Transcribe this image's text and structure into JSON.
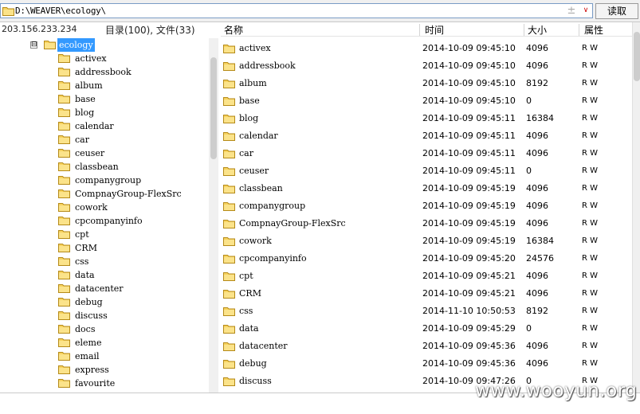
{
  "path_bar": {
    "path": "D:\\WEAVER\\ecology\\",
    "read_button": "读取",
    "add_glyph": "±",
    "dropdown_glyph": "∨"
  },
  "left": {
    "ip": "203.156.233.234",
    "counts": "目录(100), 文件(33)",
    "expander": "⊟",
    "root": "ecology",
    "tree_items": [
      "activex",
      "addressbook",
      "album",
      "base",
      "blog",
      "calendar",
      "car",
      "ceuser",
      "classbean",
      "companygroup",
      "CompnayGroup-FlexSrc",
      "cowork",
      "cpcompanyinfo",
      "cpt",
      "CRM",
      "css",
      "data",
      "datacenter",
      "debug",
      "discuss",
      "docs",
      "eleme",
      "email",
      "express",
      "favourite"
    ]
  },
  "columns": {
    "name": "名称",
    "time": "时间",
    "size": "大小",
    "attr": "属性"
  },
  "files": [
    {
      "name": "activex",
      "time": "2014-10-09 09:45:10",
      "size": "4096",
      "attr": "R W"
    },
    {
      "name": "addressbook",
      "time": "2014-10-09 09:45:10",
      "size": "4096",
      "attr": "R W"
    },
    {
      "name": "album",
      "time": "2014-10-09 09:45:10",
      "size": "8192",
      "attr": "R W"
    },
    {
      "name": "base",
      "time": "2014-10-09 09:45:10",
      "size": "0",
      "attr": "R W"
    },
    {
      "name": "blog",
      "time": "2014-10-09 09:45:11",
      "size": "16384",
      "attr": "R W"
    },
    {
      "name": "calendar",
      "time": "2014-10-09 09:45:11",
      "size": "4096",
      "attr": "R W"
    },
    {
      "name": "car",
      "time": "2014-10-09 09:45:11",
      "size": "4096",
      "attr": "R W"
    },
    {
      "name": "ceuser",
      "time": "2014-10-09 09:45:11",
      "size": "0",
      "attr": "R W"
    },
    {
      "name": "classbean",
      "time": "2014-10-09 09:45:19",
      "size": "4096",
      "attr": "R W"
    },
    {
      "name": "companygroup",
      "time": "2014-10-09 09:45:19",
      "size": "4096",
      "attr": "R W"
    },
    {
      "name": "CompnayGroup-FlexSrc",
      "time": "2014-10-09 09:45:19",
      "size": "4096",
      "attr": "R W"
    },
    {
      "name": "cowork",
      "time": "2014-10-09 09:45:19",
      "size": "16384",
      "attr": "R W"
    },
    {
      "name": "cpcompanyinfo",
      "time": "2014-10-09 09:45:20",
      "size": "24576",
      "attr": "R W"
    },
    {
      "name": "cpt",
      "time": "2014-10-09 09:45:21",
      "size": "4096",
      "attr": "R W"
    },
    {
      "name": "CRM",
      "time": "2014-10-09 09:45:21",
      "size": "4096",
      "attr": "R W"
    },
    {
      "name": "css",
      "time": "2014-11-10 10:50:53",
      "size": "8192",
      "attr": "R W"
    },
    {
      "name": "data",
      "time": "2014-10-09 09:45:29",
      "size": "0",
      "attr": "R W"
    },
    {
      "name": "datacenter",
      "time": "2014-10-09 09:45:36",
      "size": "4096",
      "attr": "R W"
    },
    {
      "name": "debug",
      "time": "2014-10-09 09:45:36",
      "size": "4096",
      "attr": "R W"
    },
    {
      "name": "discuss",
      "time": "2014-10-09 09:47:26",
      "size": "0",
      "attr": "R W"
    }
  ],
  "watermark": "www.wooyun.org",
  "icon": "folder-icon",
  "colors": {
    "selection": "#3399ff",
    "folder": "#f5c33b"
  }
}
